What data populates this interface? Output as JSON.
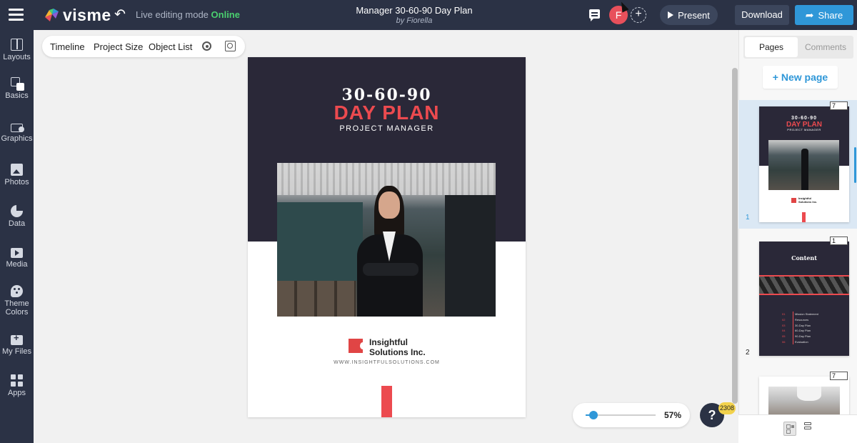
{
  "topbar": {
    "logo_text": "visme",
    "live_label": "Live editing mode",
    "live_status": "Online",
    "doc_title": "Manager 30-60-90 Day Plan",
    "doc_author": "by Fiorella",
    "avatar_initial": "F",
    "add_collaborator": "+",
    "present_label": "Present",
    "download_label": "Download",
    "share_label": "Share"
  },
  "sidebar": {
    "items": [
      {
        "label": "Layouts",
        "icon": "layouts-icon"
      },
      {
        "label": "Basics",
        "icon": "basics-icon"
      },
      {
        "label": "Graphics",
        "icon": "graphics-icon"
      },
      {
        "label": "Photos",
        "icon": "photos-icon"
      },
      {
        "label": "Data",
        "icon": "data-icon"
      },
      {
        "label": "Media",
        "icon": "media-icon"
      },
      {
        "label": "Theme",
        "label2": "Colors",
        "icon": "theme-colors-icon"
      },
      {
        "label": "My Files",
        "icon": "my-files-icon"
      },
      {
        "label": "Apps",
        "icon": "apps-icon"
      }
    ]
  },
  "toolbar": {
    "timeline": "Timeline",
    "project_size": "Project Size",
    "object_list": "Object List"
  },
  "page": {
    "line1": "30-60-90",
    "line2": "DAY PLAN",
    "subtitle": "PROJECT MANAGER",
    "company_line1": "Insightful",
    "company_line2": "Solutions Inc.",
    "website": "WWW.INSIGHTFULSOLUTIONS.COM"
  },
  "zoom": {
    "value_percent": 57,
    "label": "57%"
  },
  "help": {
    "label": "?",
    "badge": "2308"
  },
  "right_panel": {
    "tab_pages": "Pages",
    "tab_comments": "Comments",
    "new_page": "+ New page",
    "pages": [
      {
        "number": "1",
        "badge": "7"
      },
      {
        "number": "2",
        "badge": "1"
      },
      {
        "number": "",
        "badge": "7"
      }
    ],
    "thumb1": {
      "line1": "30-60-90",
      "line2": "DAY PLAN",
      "subtitle": "PROJECT MANAGER",
      "company_line1": "Insightful",
      "company_line2": "Solutions Inc."
    },
    "thumb2": {
      "title": "Content",
      "items": [
        {
          "n": "01",
          "text": "Mission Statement"
        },
        {
          "n": "02",
          "text": "Resources"
        },
        {
          "n": "03",
          "text": "30-Day Plan"
        },
        {
          "n": "04",
          "text": "60-Day Plan"
        },
        {
          "n": "05",
          "text": "90-Day Plan"
        },
        {
          "n": "06",
          "text": "Evaluation"
        }
      ]
    }
  },
  "colors": {
    "topbar_bg": "#2b3245",
    "accent_blue": "#2f97d8",
    "online_green": "#4ad06f",
    "page_dark": "#2a2838",
    "page_red": "#ec4a4f"
  }
}
